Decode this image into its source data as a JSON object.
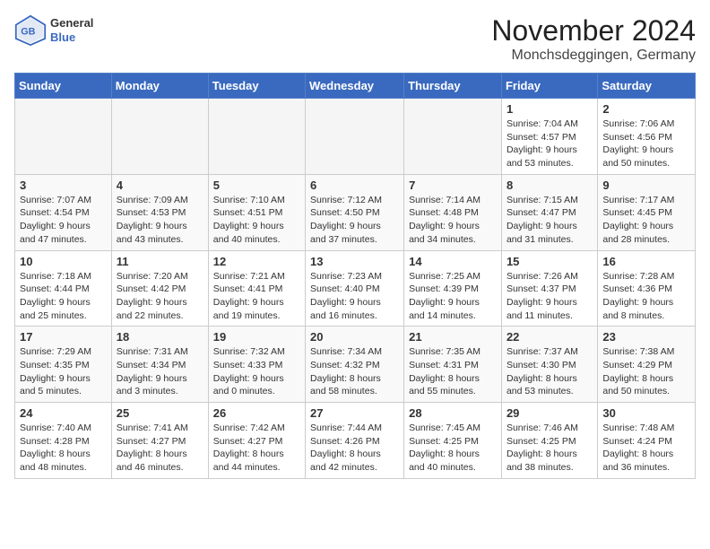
{
  "logo": {
    "general": "General",
    "blue": "Blue"
  },
  "title": "November 2024",
  "location": "Monchsdeggingen, Germany",
  "days_of_week": [
    "Sunday",
    "Monday",
    "Tuesday",
    "Wednesday",
    "Thursday",
    "Friday",
    "Saturday"
  ],
  "weeks": [
    [
      {
        "day": "",
        "detail": ""
      },
      {
        "day": "",
        "detail": ""
      },
      {
        "day": "",
        "detail": ""
      },
      {
        "day": "",
        "detail": ""
      },
      {
        "day": "",
        "detail": ""
      },
      {
        "day": "1",
        "detail": "Sunrise: 7:04 AM\nSunset: 4:57 PM\nDaylight: 9 hours and 53 minutes."
      },
      {
        "day": "2",
        "detail": "Sunrise: 7:06 AM\nSunset: 4:56 PM\nDaylight: 9 hours and 50 minutes."
      }
    ],
    [
      {
        "day": "3",
        "detail": "Sunrise: 7:07 AM\nSunset: 4:54 PM\nDaylight: 9 hours and 47 minutes."
      },
      {
        "day": "4",
        "detail": "Sunrise: 7:09 AM\nSunset: 4:53 PM\nDaylight: 9 hours and 43 minutes."
      },
      {
        "day": "5",
        "detail": "Sunrise: 7:10 AM\nSunset: 4:51 PM\nDaylight: 9 hours and 40 minutes."
      },
      {
        "day": "6",
        "detail": "Sunrise: 7:12 AM\nSunset: 4:50 PM\nDaylight: 9 hours and 37 minutes."
      },
      {
        "day": "7",
        "detail": "Sunrise: 7:14 AM\nSunset: 4:48 PM\nDaylight: 9 hours and 34 minutes."
      },
      {
        "day": "8",
        "detail": "Sunrise: 7:15 AM\nSunset: 4:47 PM\nDaylight: 9 hours and 31 minutes."
      },
      {
        "day": "9",
        "detail": "Sunrise: 7:17 AM\nSunset: 4:45 PM\nDaylight: 9 hours and 28 minutes."
      }
    ],
    [
      {
        "day": "10",
        "detail": "Sunrise: 7:18 AM\nSunset: 4:44 PM\nDaylight: 9 hours and 25 minutes."
      },
      {
        "day": "11",
        "detail": "Sunrise: 7:20 AM\nSunset: 4:42 PM\nDaylight: 9 hours and 22 minutes."
      },
      {
        "day": "12",
        "detail": "Sunrise: 7:21 AM\nSunset: 4:41 PM\nDaylight: 9 hours and 19 minutes."
      },
      {
        "day": "13",
        "detail": "Sunrise: 7:23 AM\nSunset: 4:40 PM\nDaylight: 9 hours and 16 minutes."
      },
      {
        "day": "14",
        "detail": "Sunrise: 7:25 AM\nSunset: 4:39 PM\nDaylight: 9 hours and 14 minutes."
      },
      {
        "day": "15",
        "detail": "Sunrise: 7:26 AM\nSunset: 4:37 PM\nDaylight: 9 hours and 11 minutes."
      },
      {
        "day": "16",
        "detail": "Sunrise: 7:28 AM\nSunset: 4:36 PM\nDaylight: 9 hours and 8 minutes."
      }
    ],
    [
      {
        "day": "17",
        "detail": "Sunrise: 7:29 AM\nSunset: 4:35 PM\nDaylight: 9 hours and 5 minutes."
      },
      {
        "day": "18",
        "detail": "Sunrise: 7:31 AM\nSunset: 4:34 PM\nDaylight: 9 hours and 3 minutes."
      },
      {
        "day": "19",
        "detail": "Sunrise: 7:32 AM\nSunset: 4:33 PM\nDaylight: 9 hours and 0 minutes."
      },
      {
        "day": "20",
        "detail": "Sunrise: 7:34 AM\nSunset: 4:32 PM\nDaylight: 8 hours and 58 minutes."
      },
      {
        "day": "21",
        "detail": "Sunrise: 7:35 AM\nSunset: 4:31 PM\nDaylight: 8 hours and 55 minutes."
      },
      {
        "day": "22",
        "detail": "Sunrise: 7:37 AM\nSunset: 4:30 PM\nDaylight: 8 hours and 53 minutes."
      },
      {
        "day": "23",
        "detail": "Sunrise: 7:38 AM\nSunset: 4:29 PM\nDaylight: 8 hours and 50 minutes."
      }
    ],
    [
      {
        "day": "24",
        "detail": "Sunrise: 7:40 AM\nSunset: 4:28 PM\nDaylight: 8 hours and 48 minutes."
      },
      {
        "day": "25",
        "detail": "Sunrise: 7:41 AM\nSunset: 4:27 PM\nDaylight: 8 hours and 46 minutes."
      },
      {
        "day": "26",
        "detail": "Sunrise: 7:42 AM\nSunset: 4:27 PM\nDaylight: 8 hours and 44 minutes."
      },
      {
        "day": "27",
        "detail": "Sunrise: 7:44 AM\nSunset: 4:26 PM\nDaylight: 8 hours and 42 minutes."
      },
      {
        "day": "28",
        "detail": "Sunrise: 7:45 AM\nSunset: 4:25 PM\nDaylight: 8 hours and 40 minutes."
      },
      {
        "day": "29",
        "detail": "Sunrise: 7:46 AM\nSunset: 4:25 PM\nDaylight: 8 hours and 38 minutes."
      },
      {
        "day": "30",
        "detail": "Sunrise: 7:48 AM\nSunset: 4:24 PM\nDaylight: 8 hours and 36 minutes."
      }
    ]
  ]
}
